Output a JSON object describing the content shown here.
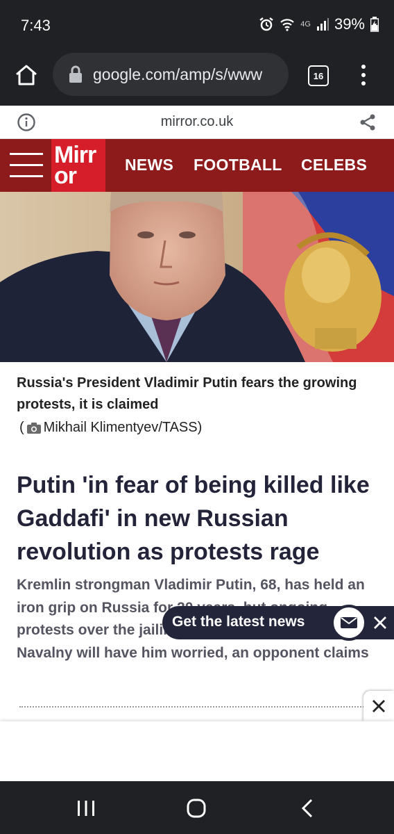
{
  "status_bar": {
    "time": "7:43",
    "network": "4G",
    "battery": "39%"
  },
  "browser": {
    "url": "google.com/amp/s/www",
    "tab_count": "16"
  },
  "amp_header": {
    "domain": "mirror.co.uk"
  },
  "site_nav": {
    "logo_line1": "Mirr",
    "logo_line2": "or",
    "items": [
      "NEWS",
      "FOOTBALL",
      "CELEBS"
    ]
  },
  "article": {
    "image_caption": "Russia's President Vladimir Putin fears the growing protests, it is claimed",
    "image_credit_open": "(",
    "image_credit": "Mikhail Klimentyev/TASS)",
    "headline": "Putin 'in fear of being killed like Gaddafi' in new Russian revolution as protests rage",
    "standfirst": "Kremlin strongman Vladimir Putin, 68, has held an iron grip on Russia for 20 years, but ongoing protests over the jailing of political rival Alexi Navalny will have him worried, an opponent claims"
  },
  "news_popup": {
    "label": "Get the latest news"
  },
  "colors": {
    "mirror_red": "#d61e2a",
    "nav_maroon": "#8e1b1b",
    "headline_navy": "#232339"
  }
}
